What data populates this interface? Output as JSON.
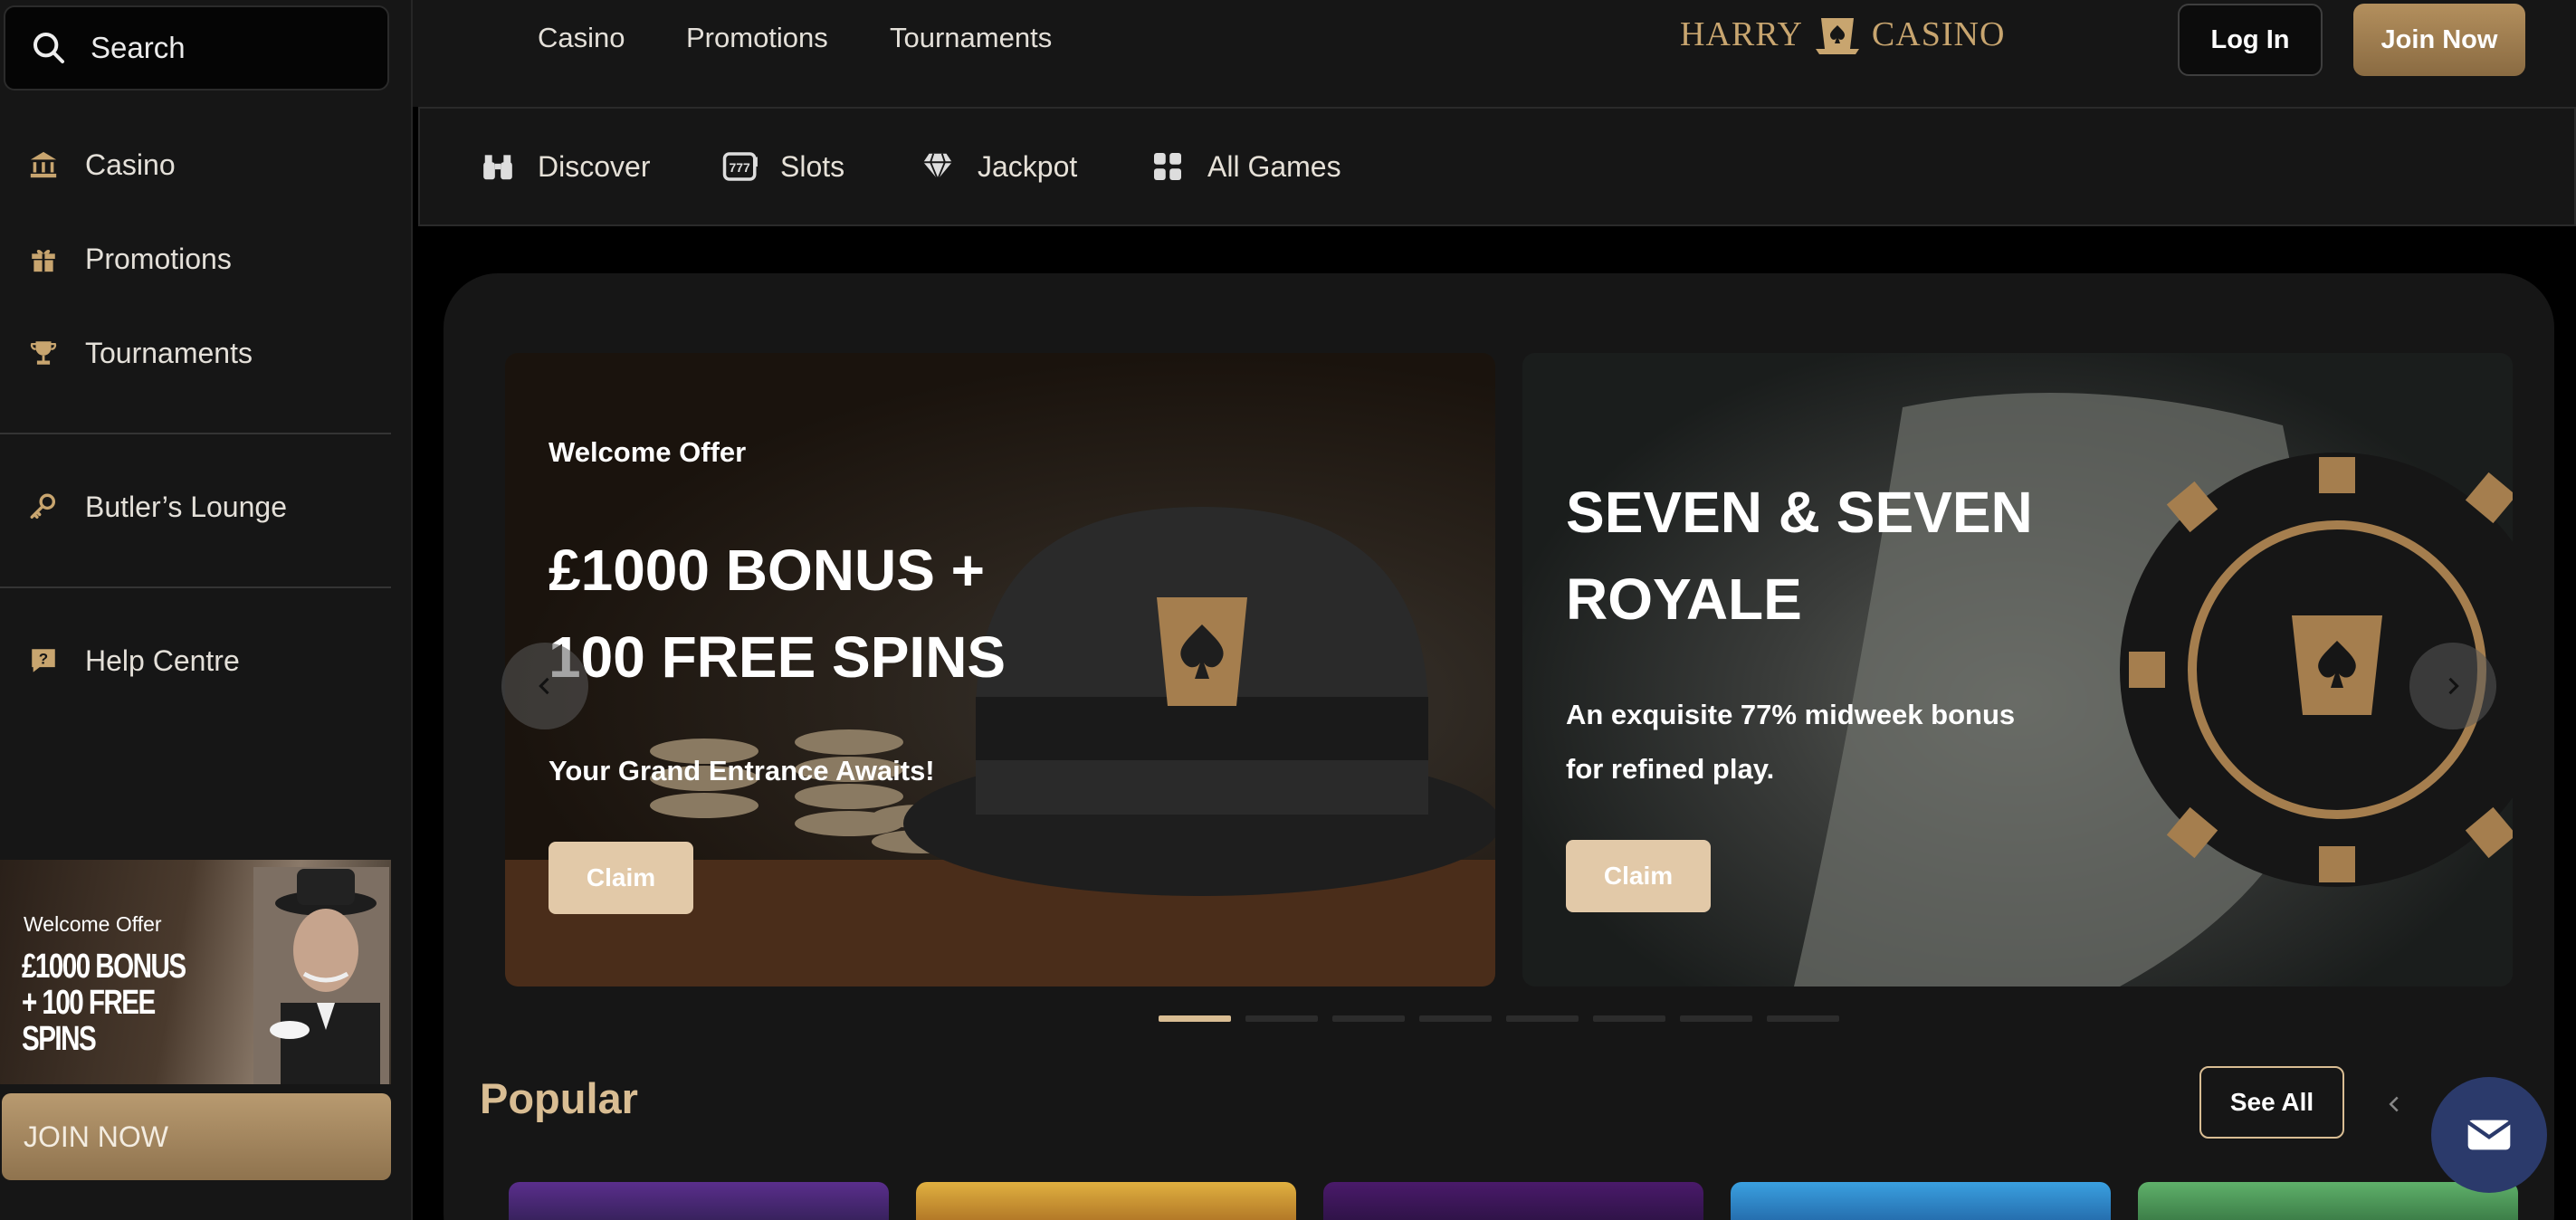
{
  "sidebar": {
    "search_label": "Search",
    "items": [
      {
        "label": "Casino",
        "icon": "bank-icon"
      },
      {
        "label": "Promotions",
        "icon": "gift-icon"
      },
      {
        "label": "Tournaments",
        "icon": "trophy-icon"
      },
      {
        "label": "Butler’s Lounge",
        "icon": "key-icon"
      },
      {
        "label": "Help Centre",
        "icon": "help-chat-icon"
      }
    ],
    "banner": {
      "kicker": "Welcome Offer",
      "headline": "£1000 BONUS + 100 FREE SPINS"
    },
    "join_label": "JOIN NOW"
  },
  "topnav": {
    "links": [
      "Casino",
      "Promotions",
      "Tournaments"
    ],
    "logo_left": "HARRY",
    "logo_right": "CASINO",
    "login_label": "Log In",
    "join_label": "Join Now"
  },
  "categories": [
    {
      "label": "Discover",
      "icon": "binoculars-icon"
    },
    {
      "label": "Slots",
      "icon": "slot-777-icon"
    },
    {
      "label": "Jackpot",
      "icon": "diamond-icon"
    },
    {
      "label": "All Games",
      "icon": "grid-icon"
    }
  ],
  "slides": [
    {
      "kicker": "Welcome Offer",
      "title_line1": "£1000 BONUS +",
      "title_line2": "100 FREE SPINS",
      "subtitle": "Your Grand Entrance Awaits!",
      "cta": "Claim"
    },
    {
      "title_line1": "SEVEN & SEVEN",
      "title_line2": "ROYALE",
      "subtitle_line1": "An exquisite 77% midweek bonus",
      "subtitle_line2": "for refined play.",
      "cta": "Claim"
    }
  ],
  "carousel": {
    "pages": 8,
    "active": 1
  },
  "popular": {
    "title": "Popular",
    "see_all": "See All"
  },
  "colors": {
    "accent": "#d9bd93",
    "gold": "#c8a56f",
    "panel": "#161616",
    "claim": "#e2c9a8",
    "mail": "#2b3a6b"
  }
}
